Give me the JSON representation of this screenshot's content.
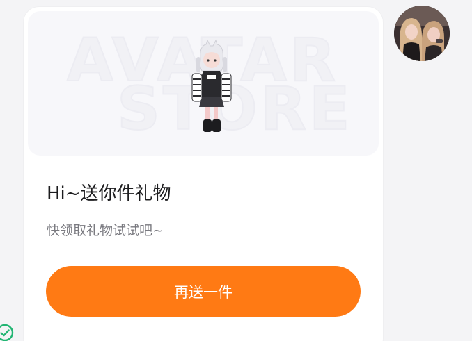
{
  "banner": {
    "watermark_line1": "AVATAR",
    "watermark_line2": "STORE"
  },
  "card": {
    "title": "Hi~送你件礼物",
    "subtitle": "快领取礼物试试吧~",
    "button_label": "再送一件"
  },
  "colors": {
    "accent": "#ff7a14",
    "background": "#f4f4f6",
    "card": "#ffffff",
    "status_check": "#22b573"
  },
  "icons": {
    "avatar": "user-avatar-photo",
    "status": "check-circle-icon"
  }
}
